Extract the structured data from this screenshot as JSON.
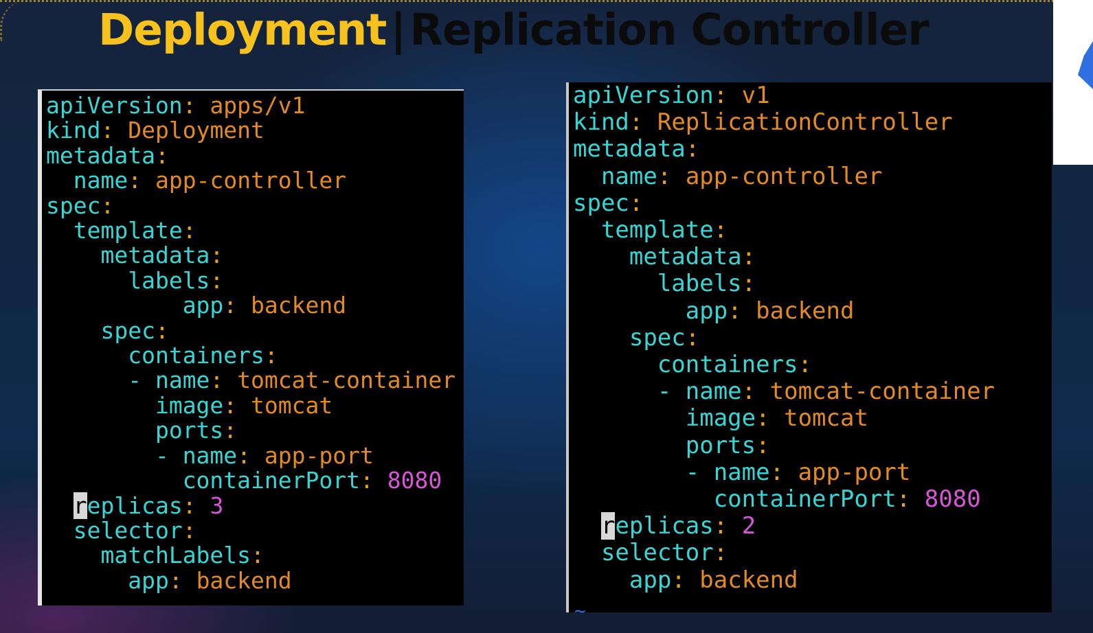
{
  "title": {
    "left": "Deployment",
    "separator": "|",
    "right": "Replication Controller"
  },
  "colors": {
    "title_highlight": "#f7c21d",
    "yaml_key": "#37d6d6",
    "yaml_value": "#e38a22",
    "yaml_number": "#d855d8",
    "terminal_bg": "#000000"
  },
  "deployment": {
    "lines": [
      {
        "indent": "",
        "key": "apiVersion",
        "value": "apps/v1"
      },
      {
        "indent": "",
        "key": "kind",
        "value": "Deployment"
      },
      {
        "indent": "",
        "key": "metadata",
        "value": ""
      },
      {
        "indent": "  ",
        "key": "name",
        "value": "app-controller"
      },
      {
        "indent": "",
        "key": "spec",
        "value": ""
      },
      {
        "indent": "  ",
        "key": "template",
        "value": ""
      },
      {
        "indent": "    ",
        "key": "metadata",
        "value": ""
      },
      {
        "indent": "      ",
        "key": "labels",
        "value": ""
      },
      {
        "indent": "          ",
        "key": "app",
        "value": "backend"
      },
      {
        "indent": "    ",
        "key": "spec",
        "value": ""
      },
      {
        "indent": "      ",
        "key": "containers",
        "value": ""
      },
      {
        "indent": "      - ",
        "key": "name",
        "value": "tomcat-container"
      },
      {
        "indent": "        ",
        "key": "image",
        "value": "tomcat"
      },
      {
        "indent": "        ",
        "key": "ports",
        "value": ""
      },
      {
        "indent": "        - ",
        "key": "name",
        "value": "app-port"
      },
      {
        "indent": "          ",
        "key": "containerPort",
        "value": "8080",
        "number": true
      },
      {
        "indent": "  ",
        "key": "replicas",
        "value": "3",
        "number": true,
        "cursor": true
      },
      {
        "indent": "  ",
        "key": "selector",
        "value": ""
      },
      {
        "indent": "    ",
        "key": "matchLabels",
        "value": ""
      },
      {
        "indent": "      ",
        "key": "app",
        "value": "backend"
      }
    ]
  },
  "replication_controller": {
    "lines": [
      {
        "indent": "",
        "key": "apiVersion",
        "value": "v1"
      },
      {
        "indent": "",
        "key": "kind",
        "value": "ReplicationController"
      },
      {
        "indent": "",
        "key": "metadata",
        "value": ""
      },
      {
        "indent": "  ",
        "key": "name",
        "value": "app-controller"
      },
      {
        "indent": "",
        "key": "spec",
        "value": ""
      },
      {
        "indent": "  ",
        "key": "template",
        "value": ""
      },
      {
        "indent": "    ",
        "key": "metadata",
        "value": ""
      },
      {
        "indent": "      ",
        "key": "labels",
        "value": ""
      },
      {
        "indent": "        ",
        "key": "app",
        "value": "backend"
      },
      {
        "indent": "    ",
        "key": "spec",
        "value": ""
      },
      {
        "indent": "      ",
        "key": "containers",
        "value": ""
      },
      {
        "indent": "      - ",
        "key": "name",
        "value": "tomcat-container"
      },
      {
        "indent": "        ",
        "key": "image",
        "value": "tomcat"
      },
      {
        "indent": "        ",
        "key": "ports",
        "value": ""
      },
      {
        "indent": "        - ",
        "key": "name",
        "value": "app-port"
      },
      {
        "indent": "          ",
        "key": "containerPort",
        "value": "8080",
        "number": true
      },
      {
        "indent": "  ",
        "key": "replicas",
        "value": "2",
        "number": true,
        "cursor": true
      },
      {
        "indent": "  ",
        "key": "selector",
        "value": ""
      },
      {
        "indent": "    ",
        "key": "app",
        "value": "backend"
      }
    ],
    "end_marker": "~"
  }
}
